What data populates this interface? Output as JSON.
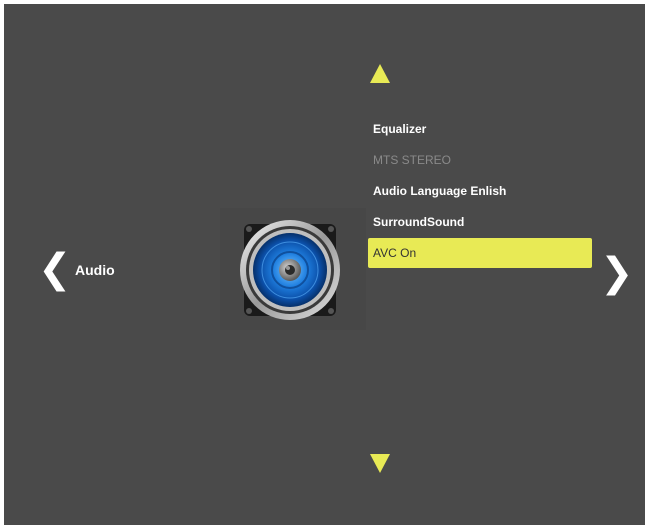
{
  "category": {
    "label": "Audio",
    "prev_glyph": "❮",
    "next_glyph": "❯"
  },
  "icon": {
    "name": "speaker-icon"
  },
  "colors": {
    "background": "#4a4a4a",
    "accent": "#e8ea55",
    "text": "#ffffff",
    "disabled_text": "#8a8a8a"
  },
  "menu": {
    "items": [
      {
        "label": "Equalizer",
        "state": "normal"
      },
      {
        "label": "MTS STEREO",
        "state": "disabled"
      },
      {
        "label": "Audio Language Enlish",
        "state": "normal"
      },
      {
        "label": "SurroundSound",
        "state": "normal"
      },
      {
        "label": "AVC On",
        "state": "selected"
      }
    ]
  }
}
